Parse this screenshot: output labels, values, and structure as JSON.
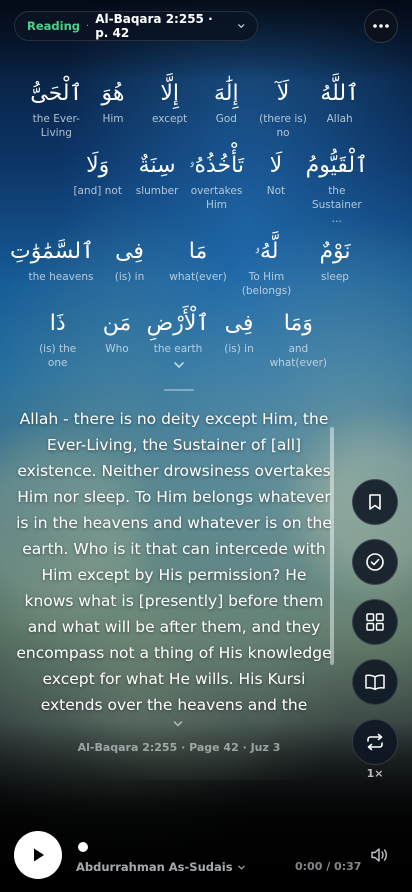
{
  "header": {
    "mode": "Reading",
    "separator": "·",
    "reference": "Al-Baqara 2:255 · p. 42"
  },
  "words": [
    [
      {
        "ar": "ٱللَّهُ",
        "en": "Allah"
      },
      {
        "ar": "لَآ",
        "en": "(there is) no"
      },
      {
        "ar": "إِلَٰهَ",
        "en": "God"
      },
      {
        "ar": "إِلَّا",
        "en": "except"
      },
      {
        "ar": "هُوَ",
        "en": "Him"
      },
      {
        "ar": "ٱلْحَىُّ",
        "en": "the Ever-Living"
      }
    ],
    [
      {
        "ar": "ٱلْقَيُّومُ",
        "en": "the Sustainer …"
      },
      {
        "ar": "لَا",
        "en": "Not"
      },
      {
        "ar": "تَأْخُذُهُۥ",
        "en": "overtakes Him"
      },
      {
        "ar": "سِنَةٌ",
        "en": "slumber"
      },
      {
        "ar": "وَلَا",
        "en": "[and] not"
      }
    ],
    [
      {
        "ar": "نَوْمٌ",
        "en": "sleep"
      },
      {
        "ar": "لَّهُۥ",
        "en": "To Him (belongs)"
      },
      {
        "ar": "مَا",
        "en": "what(ever)"
      },
      {
        "ar": "فِى",
        "en": "(is) in"
      },
      {
        "ar": "ٱلسَّمَٰوَٰتِ",
        "en": "the heavens"
      }
    ],
    [
      {
        "ar": "وَمَا",
        "en": "and what(ever)"
      },
      {
        "ar": "فِى",
        "en": "(is) in"
      },
      {
        "ar": "ٱلْأَرْضِ",
        "en": "the earth"
      },
      {
        "ar": "مَن",
        "en": "Who"
      },
      {
        "ar": "ذَا",
        "en": "(is) the one"
      }
    ]
  ],
  "translation": "Allah - there is no deity except Him, the Ever-Living, the Sustainer of [all] existence. Neither drowsiness overtakes Him nor sleep. To Him belongs whatever is in the heavens and whatever is on the earth. Who is it that can intercede with Him except by His permission? He knows what is [presently] before them and what will be after them, and they encompass not a thing of His knowledge except for what He wills. His Kursi extends over the heavens and the earth, and their preservation tires Him not. And He is the Most High, the Most Great.",
  "meta": "Al-Baqara 2:255 · Page 42 · Juz 3",
  "side_buttons": [
    {
      "icon": "bookmark-icon"
    },
    {
      "icon": "check-circle-icon"
    },
    {
      "icon": "grid-icon"
    },
    {
      "icon": "book-open-icon"
    },
    {
      "icon": "repeat-icon"
    }
  ],
  "speed": "1×",
  "player": {
    "reciter": "Abdurrahman As-Sudais",
    "time": "0:00 / 0:37",
    "progress": 0
  },
  "colors": {
    "accent": "#4ed08c"
  }
}
